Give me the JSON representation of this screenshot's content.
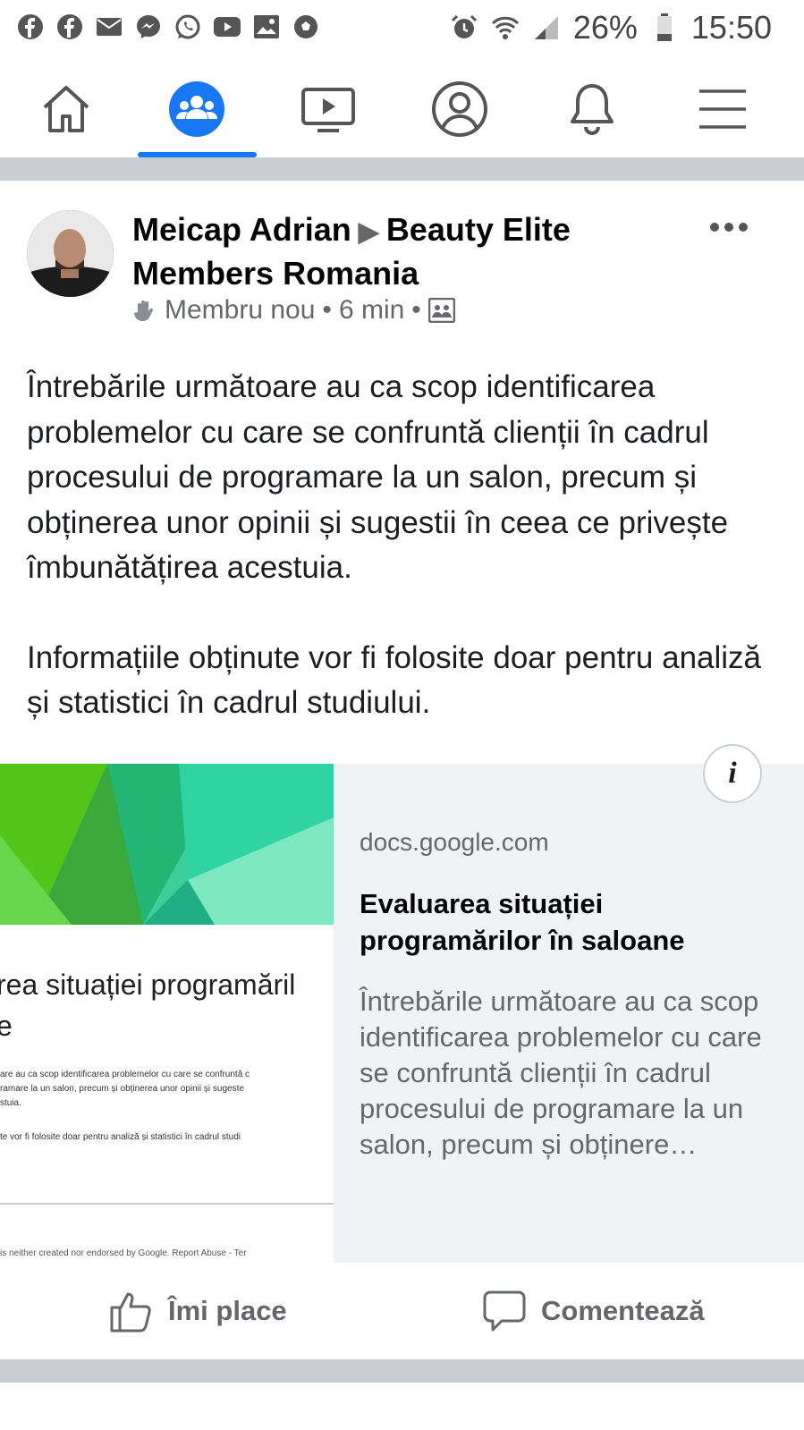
{
  "status_bar": {
    "battery": "26%",
    "time": "15:50",
    "left_icons": [
      "facebook-icon",
      "facebook-icon",
      "mail-icon",
      "messenger-icon",
      "whatsapp-icon",
      "youtube-icon",
      "gallery-icon",
      "soccer-icon"
    ],
    "right_icons": [
      "alarm-icon",
      "wifi-icon",
      "signal-icon",
      "battery-icon"
    ]
  },
  "navbar": {
    "items": [
      "home-icon",
      "groups-icon",
      "watch-icon",
      "profile-icon",
      "notifications-icon",
      "menu-icon"
    ],
    "active": "groups-icon",
    "accent": "#1877f2"
  },
  "post": {
    "author": "Meicap Adrian",
    "group": "Beauty Elite Members Romania",
    "badge": "Membru nou",
    "time": "6 min",
    "paragraph1": "Întrebările următoare au ca scop identificarea problemelor cu care se confruntă clienții în cadrul procesului de programare la un salon, precum și obținerea unor opinii și sugestii în ceea ce privește îmbunătățirea acestuia.",
    "paragraph2": "Informațiile obținute vor fi folosite doar pentru analiză și statistici în cadrul studiului."
  },
  "link_card": {
    "domain": "docs.google.com",
    "title": "Evaluarea situației programărilor în saloane",
    "description": "Întrebările următoare au ca scop identificarea problemelor cu care se confruntă clienții în cadrul procesului de programare la un salon, precum și obținere…",
    "info_label": "i",
    "thumbnail": {
      "title_line1": "rea situației programăril",
      "title_line2": "e",
      "line1": "are au ca scop identificarea problemelor cu care se confruntă c",
      "line2": "ramare la un salon, precum și obținerea unor opinii și sugeste",
      "line3": "stuia.",
      "line4": "te vor fi folosite doar pentru analiză și statistici în cadrul studi",
      "footer": "is neither created nor endorsed by Google. Report Abuse - Ter"
    }
  },
  "actions": {
    "like": "Îmi place",
    "comment": "Comentează"
  }
}
